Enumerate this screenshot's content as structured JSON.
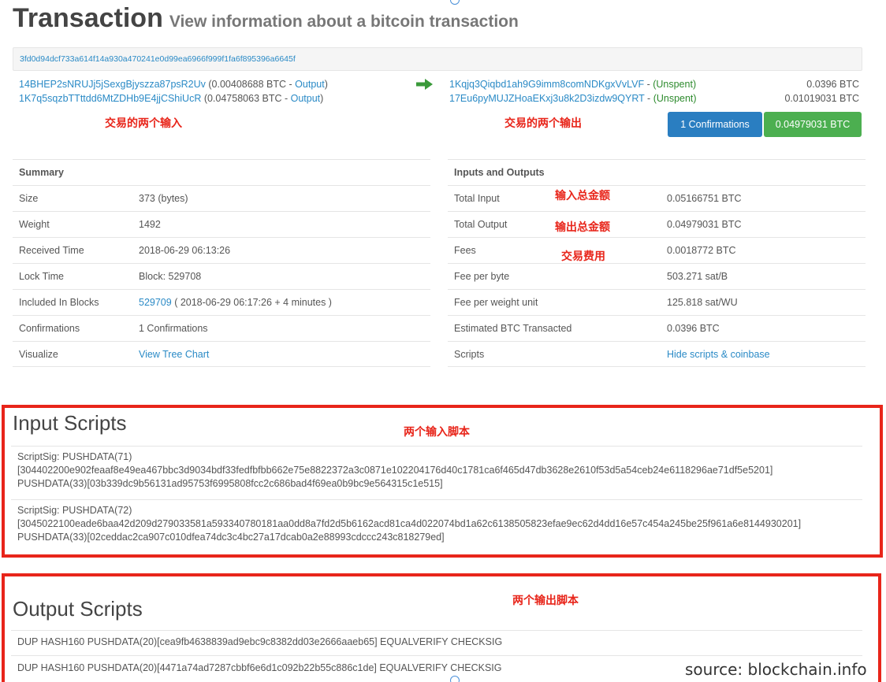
{
  "header": {
    "title": "Transaction",
    "subtitle": "View information about a bitcoin transaction"
  },
  "tx": {
    "hash": "3fd0d94dcf733a614f14a930a470241e0d99ea6966f999f1fa6f895396a6645f",
    "inputs": [
      {
        "address": "14BHEP2sNRUJj5jSexgBjyszza87psR2Uv",
        "pre": " (0.00408688 BTC - ",
        "link": "Output",
        "post": ")"
      },
      {
        "address": "1K7q5sqzbTTttdd6MtZDHb9E4jjCShiUcR",
        "pre": " (0.04758063 BTC - ",
        "link": "Output",
        "post": ")"
      }
    ],
    "outputs": [
      {
        "address": "1Kqjq3Qiqbd1ah9G9imm8comNDKgxVvLVF",
        "sep": " - ",
        "status": "(Unspent)",
        "amount": "0.0396 BTC"
      },
      {
        "address": "17Eu6pyMUJZHoaEKxj3u8k2D3izdw9QYRT",
        "sep": " - ",
        "status": "(Unspent)",
        "amount": "0.01019031 BTC"
      }
    ],
    "confirmations_button": "1 Confirmations",
    "amount_button": "0.04979031 BTC"
  },
  "annotations": {
    "inputs": "交易的两个输入",
    "outputs": "交易的两个输出",
    "total_input": "输入总金额",
    "total_output": "输出总金额",
    "fees": "交易费用",
    "input_scripts": "两个输入脚本",
    "output_scripts": "两个输出脚本"
  },
  "summary": {
    "heading": "Summary",
    "rows": [
      {
        "label": "Size",
        "value": "373 (bytes)"
      },
      {
        "label": "Weight",
        "value": "1492"
      },
      {
        "label": "Received Time",
        "value": "2018-06-29 06:13:26"
      },
      {
        "label": "Lock Time",
        "value": "Block: 529708"
      },
      {
        "label": "Included In Blocks",
        "link": "529709",
        "value": " ( 2018-06-29 06:17:26 + 4 minutes )"
      },
      {
        "label": "Confirmations",
        "value": "1 Confirmations"
      },
      {
        "label": "Visualize",
        "link": "View Tree Chart"
      }
    ]
  },
  "io": {
    "heading": "Inputs and Outputs",
    "rows": [
      {
        "label": "Total Input",
        "value": "0.05166751 BTC"
      },
      {
        "label": "Total Output",
        "value": "0.04979031 BTC"
      },
      {
        "label": "Fees",
        "value": "0.0018772 BTC"
      },
      {
        "label": "Fee per byte",
        "value": "503.271 sat/B"
      },
      {
        "label": "Fee per weight unit",
        "value": "125.818 sat/WU"
      },
      {
        "label": "Estimated BTC Transacted",
        "value": "0.0396 BTC"
      },
      {
        "label": "Scripts",
        "link": "Hide scripts & coinbase"
      }
    ]
  },
  "input_scripts": {
    "title": "Input Scripts",
    "scripts": [
      {
        "line1": "ScriptSig: PUSHDATA(71)",
        "line2": "[304402200e902feaaf8e49ea467bbc3d9034bdf33fedfbfbb662e75e8822372a3c0871e102204176d40c1781ca6f465d47db3628e2610f53d5a54ceb24e6118296ae71df5e5201]",
        "line3": "PUSHDATA(33)[03b339dc9b56131ad95753f6995808fcc2c686bad4f69ea0b9bc9e564315c1e515]"
      },
      {
        "line1": "ScriptSig: PUSHDATA(72)",
        "line2": "[3045022100eade6baa42d209d279033581a593340780181aa0dd8a7fd2d5b6162acd81ca4d022074bd1a62c6138505823efae9ec62d4dd16e57c454a245be25f961a6e8144930201]",
        "line3": "PUSHDATA(33)[02ceddac2ca907c010dfea74dc3c4bc27a17dcab0a2e88993cdccc243c818279ed]"
      }
    ]
  },
  "output_scripts": {
    "title": "Output Scripts",
    "scripts": [
      "DUP HASH160 PUSHDATA(20)[cea9fb4638839ad9ebc9c8382dd03e2666aaeb65] EQUALVERIFY CHECKSIG",
      "DUP HASH160 PUSHDATA(20)[4471a74ad7287cbbf6e6d1c092b22b55c886c1de] EQUALVERIFY CHECKSIG"
    ]
  },
  "source": "source: blockchain.info",
  "colors": {
    "link": "#2a8ac6",
    "annotation": "#e8251a",
    "confirm_btn": "#2a7ec1",
    "amount_btn": "#4caf50",
    "unspent": "#2e8b2e"
  },
  "icons": {
    "arrow": "right-arrow-icon"
  }
}
